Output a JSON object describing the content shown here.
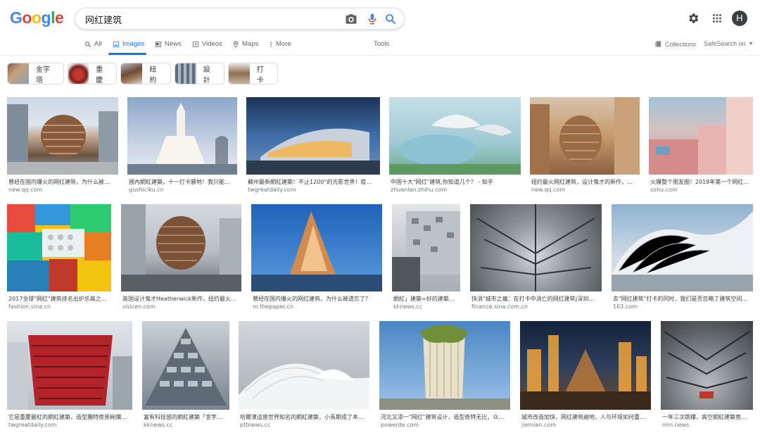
{
  "header": {
    "logo": [
      "G",
      "o",
      "o",
      "g",
      "l",
      "e"
    ],
    "logo_colors": [
      "#4285f4",
      "#ea4335",
      "#fbbc05",
      "#4285f4",
      "#34a853",
      "#ea4335"
    ],
    "query": "网红建筑",
    "avatar_letter": "H"
  },
  "tabs": {
    "all": "All",
    "images": "Images",
    "news": "News",
    "videos": "Videos",
    "maps": "Maps",
    "more": "More",
    "tools": "Tools",
    "collections": "Collections",
    "safesearch": "SafeSearch on"
  },
  "chips": [
    {
      "label": "金字塔"
    },
    {
      "label": "重慶"
    },
    {
      "label": "紐約"
    },
    {
      "label": "設計"
    },
    {
      "label": "打卡"
    }
  ],
  "results": {
    "row1": [
      {
        "title": "曾经在国内爆火的网红建筑，为什么被…",
        "source": "new.qq.com"
      },
      {
        "title": "國內網紅建築，十一打卡勝地！我只能…",
        "source": "gushiciku.cn"
      },
      {
        "title": "蘇州最新網紅建築！不止1200°的光影世界！疫…",
        "source": "twgreatdaily.com"
      },
      {
        "title": "中国十大\"网红\"建筑,你知道几个？ - 知乎",
        "source": "zhuanlan.zhihu.com"
      },
      {
        "title": "纽约最火网红建筑，设计鬼才的新作，…",
        "source": "new.qq.com"
      },
      {
        "title": "火爆整个朋友圈！2018年第一个网红…",
        "source": "sohu.com"
      }
    ],
    "row2": [
      {
        "title": "2017全球\"网红\"建筑排名出炉乐高之…",
        "source": "fashion.sina.cn"
      },
      {
        "title": "英国设计鬼才Heatherwick新作，纽约最火…",
        "source": "sisicen.com"
      },
      {
        "title": "曾经在国内爆火的网红建筑，为什么被遗忘了？",
        "source": "m.thepaper.cn"
      },
      {
        "title": "網紅」建築=好的建築？ …",
        "source": "kknews.cc"
      },
      {
        "title": "快消\"城市之痛：在打卡中消亡的网红建筑|深圳…",
        "source": "finance.sina.com.cn"
      },
      {
        "title": "去\"网红建筑\"打卡的同时，我们是否忽略了建筑空间…",
        "source": "163.com"
      }
    ],
    "row3": [
      {
        "title": "它是重慶最紅的網紅建築，造型獨特夜景絢爛…",
        "source": "twgreatdaily.com"
      },
      {
        "title": "富有科技感的網紅建築「金字…",
        "source": "kknews.cc"
      },
      {
        "title": "哈爾濱這座世界知名的網紅建築，小長期成了本…",
        "source": "pttnews.cc"
      },
      {
        "title": "河北又添一\"网红\"建筑设计，造型奇特无比，众…",
        "source": "powerde.com"
      },
      {
        "title": "城市改造加快，网红建筑遍地，人与环境如何重…",
        "source": "jiemian.com"
      },
      {
        "title": "一年三次跳樓，高空網紅建築竟…",
        "source": "min.news"
      }
    ]
  }
}
